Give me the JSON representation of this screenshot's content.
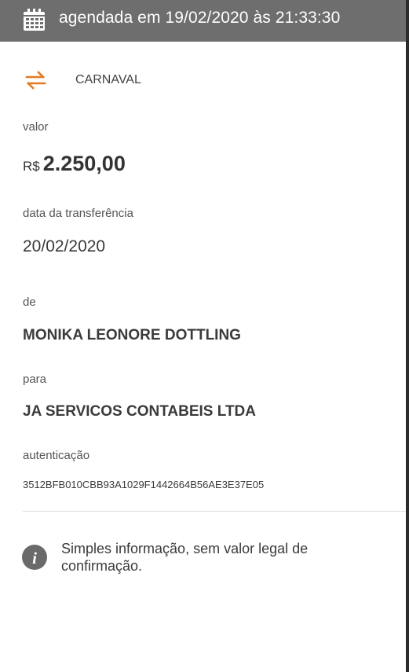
{
  "header": {
    "icon": "calendar-icon",
    "title": "agendada em 19/02/2020 às 21:33:30"
  },
  "category": {
    "icon": "transfer-arrows-icon",
    "label": "CARNAVAL",
    "icon_color": "#e37b22"
  },
  "value": {
    "label": "valor",
    "currency": "R$",
    "amount": "2.250,00"
  },
  "transfer_date": {
    "label": "data da transferência",
    "value": "20/02/2020"
  },
  "from": {
    "label": "de",
    "name": "MONIKA LEONORE DOTTLING"
  },
  "to": {
    "label": "para",
    "name": "JA SERVICOS CONTABEIS LTDA"
  },
  "authentication": {
    "label": "autenticação",
    "code": "3512BFB010CBB93A1029F1442664B56AE3E37E05"
  },
  "notice": {
    "icon": "info-icon",
    "text": "Simples informação, sem valor legal de confirmação."
  },
  "colors": {
    "header_bg": "#6e6e6e",
    "accent": "#e37b22"
  }
}
